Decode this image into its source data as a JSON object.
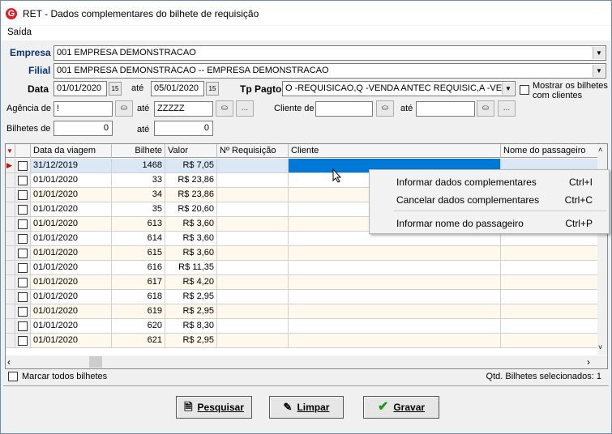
{
  "window": {
    "title": "RET - Dados complementares do bilhete de requisição",
    "icon_letter": "G"
  },
  "menu": {
    "item": "Saída"
  },
  "filters": {
    "empresa_label": "Empresa",
    "empresa_value": "001 EMPRESA DEMONSTRACAO",
    "filial_label": "Filial",
    "filial_value": "001 EMPRESA DEMONSTRACAO -- EMPRESA DEMONSTRACAO",
    "data_label": "Data",
    "data_from": "01/01/2020",
    "ate_label": "até",
    "data_to": "05/01/2020",
    "tppagto_label": "Tp Pagto",
    "tppagto_value": "O -REQUISICAO,Q -VENDA ANTEC REQUISIC,A -VEN",
    "mostrar_label": "Mostrar os bilhetes com clientes",
    "agencia_label": "Agência de",
    "agencia_from": "!",
    "agencia_to": "ZZZZZ",
    "cliente_label": "Cliente de",
    "cliente_from": "",
    "cliente_to": "",
    "bilhetes_label": "Bilhetes de",
    "bilhetes_from": "0",
    "bilhetes_to": "0"
  },
  "grid": {
    "columns": [
      "",
      "Data da viagem",
      "Bilhete",
      "Valor",
      "Nº Requisição",
      "Cliente",
      "Nome do passageiro"
    ],
    "rows": [
      {
        "data": "31/12/2019",
        "bilhete": "1468",
        "valor": "R$ 7,05"
      },
      {
        "data": "01/01/2020",
        "bilhete": "33",
        "valor": "R$ 23,86"
      },
      {
        "data": "01/01/2020",
        "bilhete": "34",
        "valor": "R$ 23,86"
      },
      {
        "data": "01/01/2020",
        "bilhete": "35",
        "valor": "R$ 20,60"
      },
      {
        "data": "01/01/2020",
        "bilhete": "613",
        "valor": "R$ 3,60"
      },
      {
        "data": "01/01/2020",
        "bilhete": "614",
        "valor": "R$ 3,60"
      },
      {
        "data": "01/01/2020",
        "bilhete": "615",
        "valor": "R$ 3,60"
      },
      {
        "data": "01/01/2020",
        "bilhete": "616",
        "valor": "R$ 11,35"
      },
      {
        "data": "01/01/2020",
        "bilhete": "617",
        "valor": "R$ 4,20"
      },
      {
        "data": "01/01/2020",
        "bilhete": "618",
        "valor": "R$ 2,95"
      },
      {
        "data": "01/01/2020",
        "bilhete": "619",
        "valor": "R$ 2,95"
      },
      {
        "data": "01/01/2020",
        "bilhete": "620",
        "valor": "R$ 8,30"
      },
      {
        "data": "01/01/2020",
        "bilhete": "621",
        "valor": "R$ 2,95"
      }
    ]
  },
  "context_menu": [
    {
      "label": "Informar dados complementares",
      "shortcut": "Ctrl+I"
    },
    {
      "label": "Cancelar dados complementares",
      "shortcut": "Ctrl+C"
    },
    {
      "label": "Informar nome do passageiro",
      "shortcut": "Ctrl+P"
    }
  ],
  "status": {
    "marcar_label": "Marcar todos bilhetes",
    "qtd_label": "Qtd. Bilhetes selecionados: 1"
  },
  "buttons": {
    "pesquisar": "Pesquisar",
    "limpar": "Limpar",
    "gravar": "Gravar"
  },
  "colors": {
    "selection": "#0078d7",
    "label_blue": "#0c2f7a",
    "row_alt": "#fff8ec",
    "app_icon": "#d8232a"
  }
}
